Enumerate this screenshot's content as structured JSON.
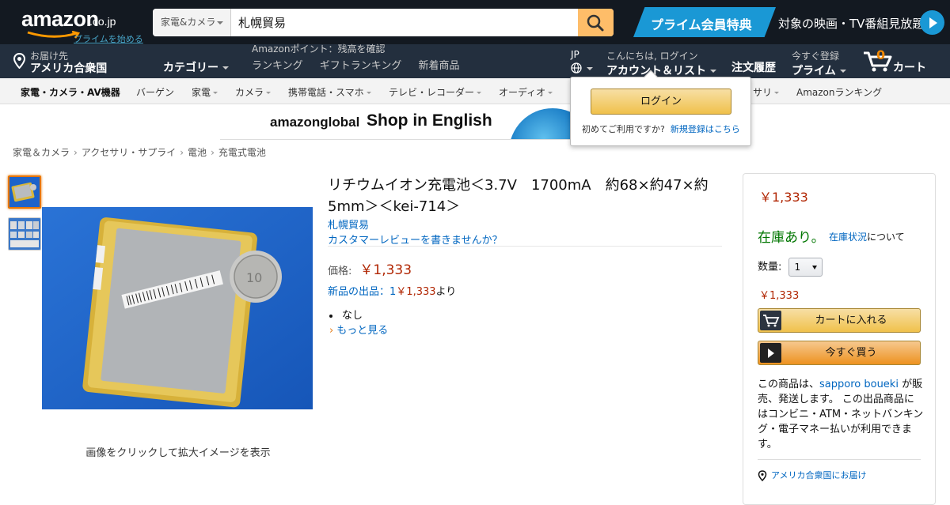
{
  "header": {
    "logo_text": "amazon",
    "logo_tld": ".co.jp",
    "prime_start_link": "プライムを始める",
    "search_category": "家電&カメラ",
    "search_value": "札幌貿易",
    "prime_banner_title": "プライム会員特典",
    "prime_banner_text": "対象の映画・TV番組見放題"
  },
  "nav": {
    "deliver_line1": "お届け先",
    "deliver_line2": "アメリカ合衆国",
    "category_menu": "カテゴリー",
    "points": "Amazonポイント：残高を確認",
    "links": [
      "ランキング",
      "ギフトランキング",
      "新着商品"
    ],
    "lang": "JP",
    "account_line1": "こんにちは, ログイン",
    "account_line2": "アカウント＆リスト",
    "orders": "注文履歴",
    "prime_line1": "今すぐ登録",
    "prime_line2": "プライム",
    "cart_count": "0",
    "cart_label": "カート"
  },
  "subnav": {
    "items": [
      "家電・カメラ・AV機器",
      "バーゲン",
      "家電",
      "カメラ",
      "携帯電話・スマホ",
      "テレビ・レコーダー",
      "オーディオ",
      "サリ",
      "Amazonランキング"
    ]
  },
  "banner": {
    "brand": "amazonglobal",
    "text": "Shop in English"
  },
  "flyout": {
    "login_button": "ログイン",
    "new_user_text": "初めてご利用ですか?",
    "register_link": "新規登録はこちら"
  },
  "breadcrumb": [
    "家電＆カメラ",
    "アクセサリ・サプライ",
    "電池",
    "充電式電池"
  ],
  "gallery": {
    "caption": "画像をクリックして拡大イメージを表示"
  },
  "product": {
    "title": "リチウムイオン充電池＜3.7V　1700mA　約68×約47×約5mm＞＜kei-714＞",
    "brand": "札幌貿易",
    "review_link": "カスタマーレビューを書きませんか？",
    "price_label": "価格:",
    "price": "￥1,333",
    "offers_text": "新品の出品：",
    "offers_count": "1",
    "offers_price": "￥1,333",
    "offers_suffix": "より",
    "bullets": [
      "なし"
    ],
    "more_link": "もっと見る"
  },
  "buybox": {
    "price": "￥1,333",
    "stock": "在庫あり。",
    "stock_link": "在庫状況",
    "stock_suffix": "について",
    "qty_label": "数量:",
    "qty_value": "1",
    "price2": "￥1,333",
    "add_to_cart": "カートに入れる",
    "buy_now": "今すぐ買う",
    "seller_prefix": "この商品は、",
    "seller_name": "sapporo boueki",
    "seller_suffix": " が販売、発送します。 この出品商品にはコンビニ・ATM・ネットバンキング・電子マネー払いが利用できます。",
    "ship_to": "アメリカ合衆国にお届け"
  },
  "colors": {
    "header_bg": "#131921",
    "nav_bg": "#232f3e",
    "price_red": "#b12704",
    "link_blue": "#0066c0",
    "stock_green": "#007600",
    "button_yellow": "#f0c14b",
    "button_orange": "#ed9220"
  }
}
